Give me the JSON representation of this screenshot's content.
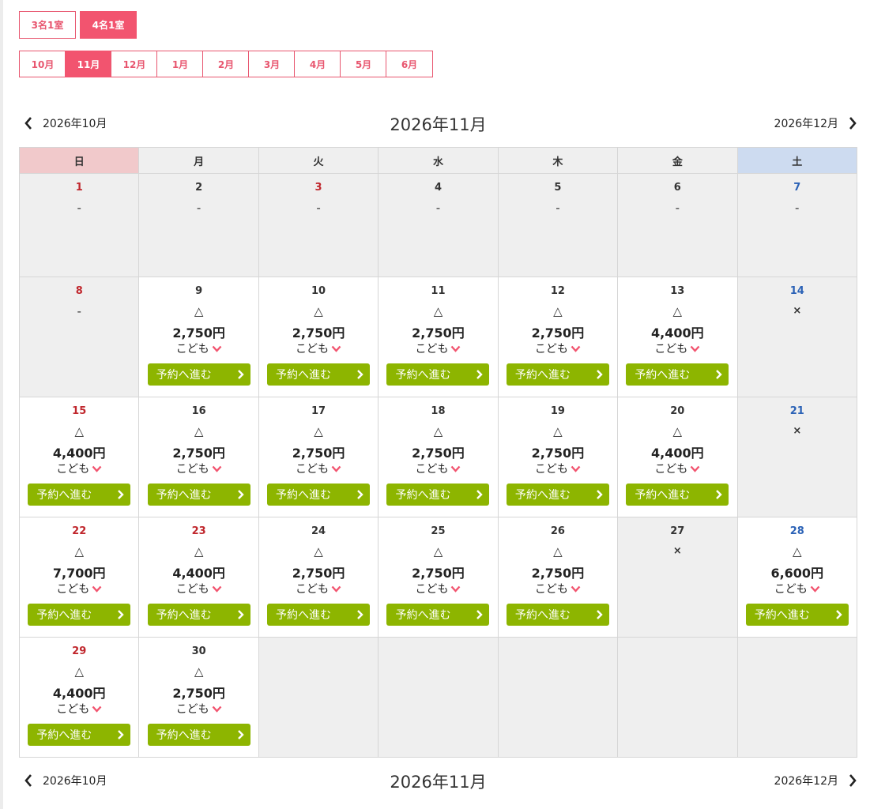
{
  "rooms": [
    {
      "label": "3名1室",
      "active": false
    },
    {
      "label": "4名1室",
      "active": true
    }
  ],
  "months": [
    {
      "label": "10月",
      "active": false
    },
    {
      "label": "11月",
      "active": true
    },
    {
      "label": "12月",
      "active": false
    },
    {
      "label": "1月",
      "active": false
    },
    {
      "label": "2月",
      "active": false
    },
    {
      "label": "3月",
      "active": false
    },
    {
      "label": "4月",
      "active": false
    },
    {
      "label": "5月",
      "active": false
    },
    {
      "label": "6月",
      "active": false
    }
  ],
  "nav": {
    "prev_label": "2026年10月",
    "current_label": "2026年11月",
    "next_label": "2026年12月"
  },
  "weekdays": [
    "日",
    "月",
    "火",
    "水",
    "木",
    "金",
    "土"
  ],
  "kids_label": "こども",
  "book_label": "予約へ進む",
  "colors": {
    "accent": "#f2546f",
    "book": "#8db500",
    "sunday_header": "#f1c9cb",
    "saturday_header": "#cddbf0",
    "holiday_text": "#c0272d",
    "saturday_text": "#2b62b6"
  },
  "weeks": [
    [
      {
        "day": "1",
        "color": "red",
        "status": "-",
        "off": true
      },
      {
        "day": "2",
        "color": "",
        "status": "-",
        "off": true
      },
      {
        "day": "3",
        "color": "red",
        "status": "-",
        "off": true
      },
      {
        "day": "4",
        "color": "",
        "status": "-",
        "off": true
      },
      {
        "day": "5",
        "color": "",
        "status": "-",
        "off": true
      },
      {
        "day": "6",
        "color": "",
        "status": "-",
        "off": true
      },
      {
        "day": "7",
        "color": "blue",
        "status": "-",
        "off": true
      }
    ],
    [
      {
        "day": "8",
        "color": "red",
        "status": "-",
        "off": true
      },
      {
        "day": "9",
        "color": "",
        "status": "△",
        "price": "2,750円"
      },
      {
        "day": "10",
        "color": "",
        "status": "△",
        "price": "2,750円"
      },
      {
        "day": "11",
        "color": "",
        "status": "△",
        "price": "2,750円"
      },
      {
        "day": "12",
        "color": "",
        "status": "△",
        "price": "2,750円"
      },
      {
        "day": "13",
        "color": "",
        "status": "△",
        "price": "4,400円"
      },
      {
        "day": "14",
        "color": "blue",
        "status": "×",
        "off": true
      }
    ],
    [
      {
        "day": "15",
        "color": "red",
        "status": "△",
        "price": "4,400円"
      },
      {
        "day": "16",
        "color": "",
        "status": "△",
        "price": "2,750円"
      },
      {
        "day": "17",
        "color": "",
        "status": "△",
        "price": "2,750円"
      },
      {
        "day": "18",
        "color": "",
        "status": "△",
        "price": "2,750円"
      },
      {
        "day": "19",
        "color": "",
        "status": "△",
        "price": "2,750円"
      },
      {
        "day": "20",
        "color": "",
        "status": "△",
        "price": "4,400円"
      },
      {
        "day": "21",
        "color": "blue",
        "status": "×",
        "off": true
      }
    ],
    [
      {
        "day": "22",
        "color": "red",
        "status": "△",
        "price": "7,700円"
      },
      {
        "day": "23",
        "color": "red",
        "status": "△",
        "price": "4,400円"
      },
      {
        "day": "24",
        "color": "",
        "status": "△",
        "price": "2,750円"
      },
      {
        "day": "25",
        "color": "",
        "status": "△",
        "price": "2,750円"
      },
      {
        "day": "26",
        "color": "",
        "status": "△",
        "price": "2,750円"
      },
      {
        "day": "27",
        "color": "",
        "status": "×",
        "off": true
      },
      {
        "day": "28",
        "color": "blue",
        "status": "△",
        "price": "6,600円"
      }
    ],
    [
      {
        "day": "29",
        "color": "red",
        "status": "△",
        "price": "4,400円"
      },
      {
        "day": "30",
        "color": "",
        "status": "△",
        "price": "2,750円"
      },
      {
        "empty": true
      },
      {
        "empty": true
      },
      {
        "empty": true
      },
      {
        "empty": true
      },
      {
        "empty": true
      }
    ]
  ]
}
